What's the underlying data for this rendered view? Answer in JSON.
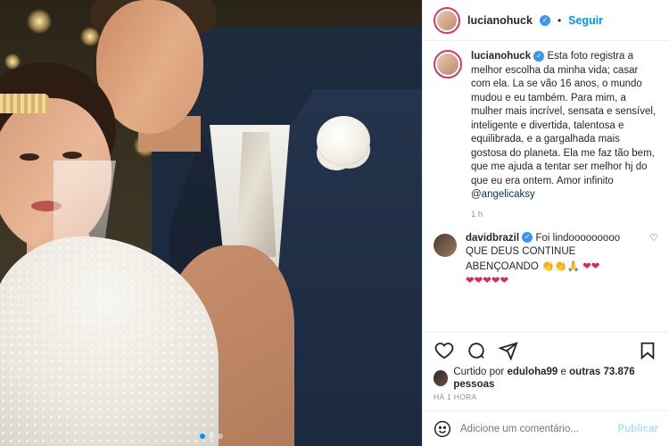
{
  "post": {
    "author": "lucianohuck",
    "verified_mark": "✓",
    "follow_separator": "•",
    "follow_label": "Seguir",
    "caption": {
      "username": "lucianohuck",
      "text": "Esta foto registra a melhor escolha da minha vida; casar com ela. La se vão 16 anos, o mundo mudou e eu também. Para mim, a mulher mais incrível, sensata e sensível, inteligente e divertida, talentosa e equilibrada, e a gargalhada mais gostosa do planeta. Ela me faz tão bem, que me ajuda a tentar ser melhor hj do que eu era ontem. Amor infinito",
      "mention": "@angelicaksy",
      "time": "1 h"
    },
    "comment": {
      "username": "davidbrazil",
      "text_line1": "Foi lindooooooooo",
      "text_line2": "QUE DEUS CONTINUE",
      "text_line3": "ABENÇOANDO",
      "emoji_line3_claps": "👏👏",
      "emoji_line3_pray": "🙏",
      "emoji_line3_hearts": "❤❤",
      "emoji_line4": "❤❤❤❤❤"
    },
    "likes": {
      "prefix": "Curtido por",
      "user": "eduloha99",
      "suffix": "e",
      "others": "outras 73.876 pessoas"
    },
    "posted_ago": "HÁ 1 HORA",
    "add_comment_placeholder": "Adicione um comentário...",
    "publish_label": "Publicar",
    "carousel": {
      "count": 3,
      "active_index": 0
    }
  },
  "icons": {
    "like": "heart-icon",
    "comment": "comment-icon",
    "share": "share-icon",
    "save": "bookmark-icon",
    "emoji": "emoji-icon"
  },
  "colors": {
    "accent": "#0095f6",
    "verified": "#3897f0",
    "text": "#262626",
    "muted": "#8e8e8e"
  }
}
